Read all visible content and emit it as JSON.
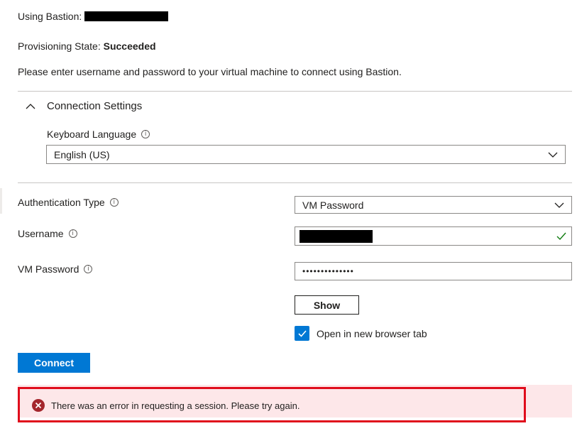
{
  "header": {
    "using_bastion_label": "Using Bastion:",
    "provisioning_label": "Provisioning State:",
    "provisioning_value": "Succeeded",
    "intro": "Please enter username and password to your virtual machine to connect using Bastion."
  },
  "connection_settings": {
    "title": "Connection Settings",
    "expanded": true,
    "keyboard_label": "Keyboard Language",
    "keyboard_value": "English (US)"
  },
  "form": {
    "auth_label": "Authentication Type",
    "auth_value": "VM Password",
    "username_label": "Username",
    "username_valid": true,
    "password_label": "VM Password",
    "password_masked": "••••••••••••••",
    "show_label": "Show",
    "open_new_tab_label": "Open in new browser tab",
    "open_new_tab_checked": true
  },
  "actions": {
    "connect_label": "Connect"
  },
  "error": {
    "message": "There was an error in requesting a session. Please try again."
  },
  "colors": {
    "accent": "#0078d4",
    "error_bg": "#fde7e9",
    "error_icon": "#a4262c",
    "highlight": "#e00c1c",
    "valid": "#107c10"
  },
  "icons": {
    "collapse": "chevron-up-icon",
    "dropdown": "chevron-down-icon",
    "info": "info-icon",
    "valid": "checkmark-icon",
    "error": "error-circle-icon"
  }
}
